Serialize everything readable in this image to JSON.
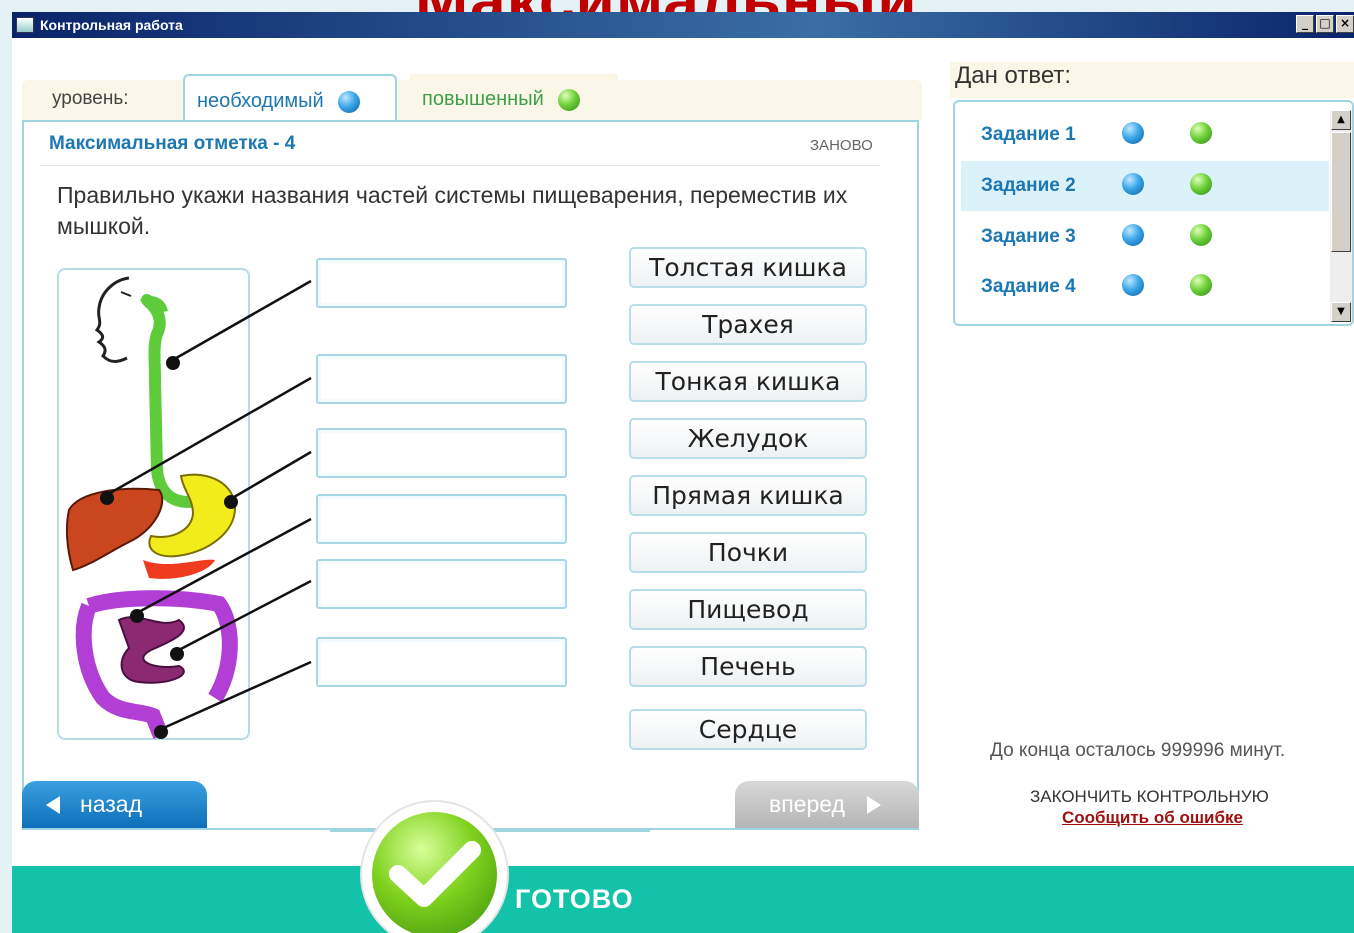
{
  "overlay_title": "Максимальный",
  "window": {
    "title": "Контрольная работа",
    "controls": [
      "_",
      "□",
      "×"
    ]
  },
  "tabs": {
    "level_label": "уровень:",
    "items": [
      {
        "label": "необходимый",
        "dot": "blue",
        "active": true
      },
      {
        "label": "повышенный",
        "dot": "green",
        "active": false
      }
    ]
  },
  "task": {
    "max_mark": "Максимальная отметка - 4",
    "redo": "ЗАНОВО",
    "question": "Правильно укажи названия частей системы пищеварения, переместив их мышкой."
  },
  "drop_zones": [
    "",
    "",
    "",
    "",
    "",
    ""
  ],
  "words": [
    "Толстая кишка",
    "Трахея",
    "Тонкая кишка",
    "Желудок",
    "Прямая кишка",
    "Почки",
    "Пищевод",
    "Печень",
    "Сердце"
  ],
  "nav": {
    "back": "назад",
    "forward": "вперед",
    "done": "ГОТОВО"
  },
  "answers": {
    "title": "Дан ответ:",
    "tasks": [
      {
        "label": "Задание 1",
        "selected": false
      },
      {
        "label": "Задание 2",
        "selected": true
      },
      {
        "label": "Задание 3",
        "selected": false
      },
      {
        "label": "Задание 4",
        "selected": false
      }
    ]
  },
  "timer": "До конца осталось 999996 минут.",
  "finish": "ЗАКОНЧИТЬ КОНТРОЛЬНУЮ",
  "report": "Сообщить об ошибке",
  "colors": {
    "accent_blue": "#1c77b3",
    "accent_green": "#12c3a9",
    "overlay_red": "#c00000"
  }
}
